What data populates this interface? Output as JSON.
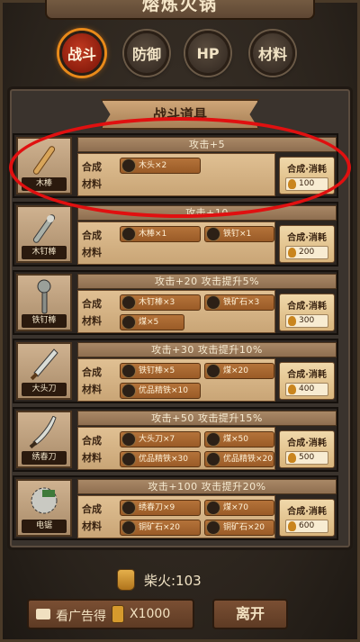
{
  "title": "熔炼火锅",
  "tabs": [
    {
      "label": "战斗",
      "active": true
    },
    {
      "label": "防御",
      "active": false
    },
    {
      "label": "HP",
      "active": false
    },
    {
      "label": "材料",
      "active": false
    }
  ],
  "section_title": "战斗道具",
  "craft_label": "合成",
  "materials_label": "材料",
  "craft_button_label": "合成·消耗",
  "recipes": [
    {
      "name": "木棒",
      "icon": "wooden-stick-icon",
      "effect": "攻击+5",
      "materials": [
        "木头×2"
      ],
      "cost": "100"
    },
    {
      "name": "木钉棒",
      "icon": "spiked-club-icon",
      "effect": "攻击+10",
      "materials": [
        "木棒×1",
        "铁钉×1"
      ],
      "cost": "200"
    },
    {
      "name": "铁钉棒",
      "icon": "iron-spiked-mace-icon",
      "effect": "攻击+20 攻击提升5%",
      "materials": [
        "木钉棒×3",
        "铁矿石×3",
        "煤×5"
      ],
      "cost": "300"
    },
    {
      "name": "大头刀",
      "icon": "broadsword-icon",
      "effect": "攻击+30 攻击提升10%",
      "materials": [
        "铁钉棒×5",
        "煤×20",
        "优品精铁×10"
      ],
      "cost": "400"
    },
    {
      "name": "绣春刀",
      "icon": "saber-icon",
      "effect": "攻击+50 攻击提升15%",
      "materials": [
        "大头刀×7",
        "煤×50",
        "优品精铁×30",
        "优品精铁×20"
      ],
      "cost": "500"
    },
    {
      "name": "电锯",
      "icon": "chainsaw-icon",
      "effect": "攻击+100 攻击提升20%",
      "materials": [
        "绣春刀×9",
        "煤×70",
        "铜矿石×20",
        "铜矿石×20"
      ],
      "cost": "600"
    }
  ],
  "firewood": "柴火:103",
  "ad_button": {
    "label": "看广告得",
    "amount": "X1000"
  },
  "leave_button": "离开",
  "colors": {
    "highlight_ring": "#e01010",
    "active_tab": "#c0391f"
  }
}
